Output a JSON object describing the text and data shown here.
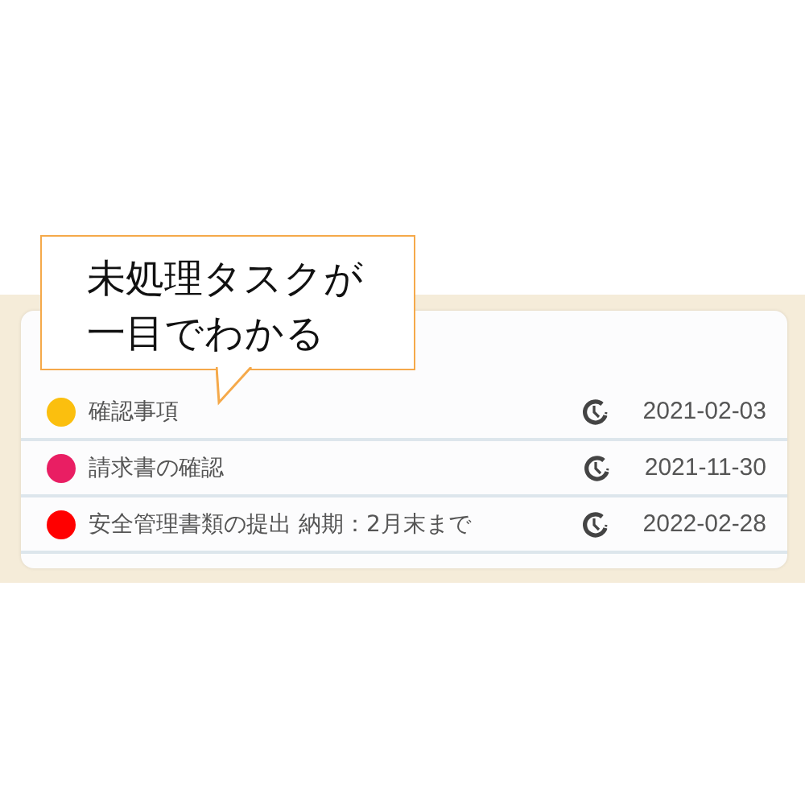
{
  "callout": {
    "lines": [
      "未処理タスクが",
      "一目でわかる"
    ]
  },
  "tasks": [
    {
      "title": "確認事項",
      "color": "#fbbf0e",
      "date": "2021-02-03"
    },
    {
      "title": "請求書の確認",
      "color": "#e91e63",
      "date": "2021-11-30"
    },
    {
      "title": "安全管理書類の提出 納期：2月末まで",
      "color": "#ff0000",
      "date": "2022-02-28"
    }
  ]
}
